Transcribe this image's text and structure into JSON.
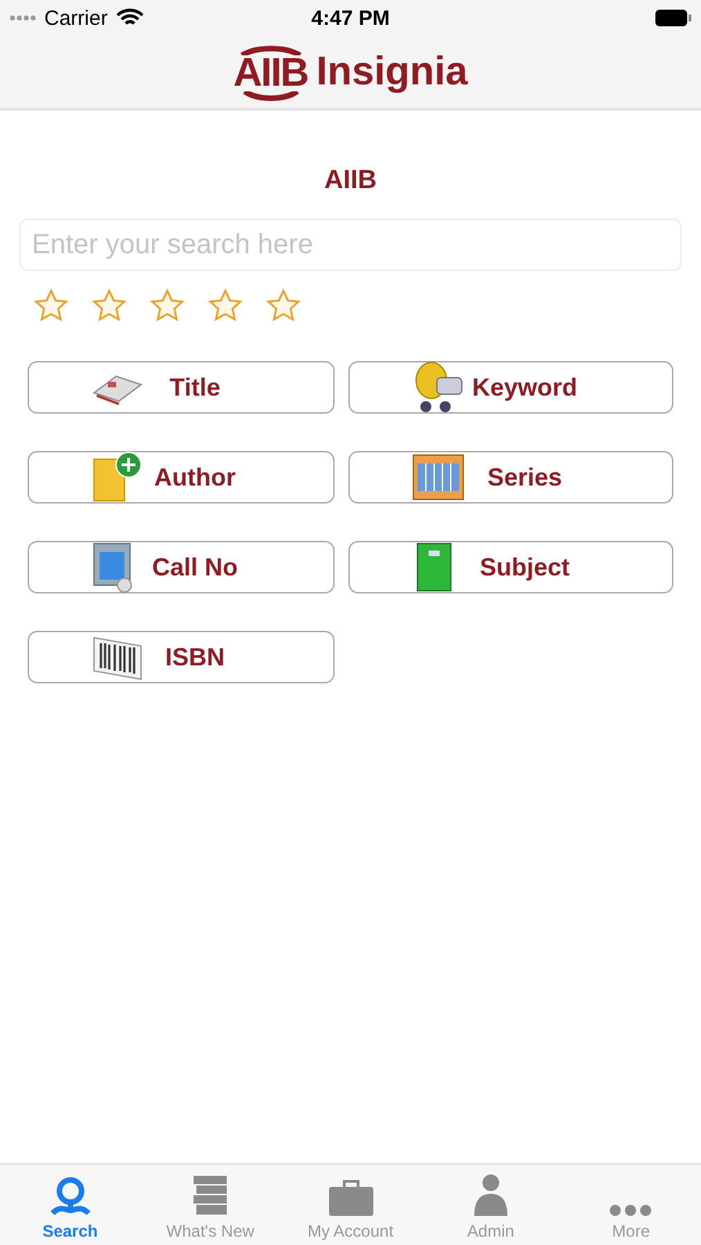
{
  "status_bar": {
    "carrier": "Carrier",
    "time": "4:47 PM"
  },
  "header": {
    "logo_mark": "AIIB",
    "logo_text": "Insignia"
  },
  "heading": "AIIB",
  "search": {
    "placeholder": "Enter your search here"
  },
  "rating": {
    "stars": 0
  },
  "search_buttons": [
    {
      "label": "Title",
      "kind": "title"
    },
    {
      "label": "Keyword",
      "kind": "keyword"
    },
    {
      "label": "Author",
      "kind": "author"
    },
    {
      "label": "Series",
      "kind": "series"
    },
    {
      "label": "Call No",
      "kind": "callno"
    },
    {
      "label": "Subject",
      "kind": "subject"
    },
    {
      "label": "ISBN",
      "kind": "isbn"
    }
  ],
  "tab_bar": [
    {
      "label": "Search",
      "kind": "search",
      "selected": true
    },
    {
      "label": "What's New",
      "kind": "books",
      "selected": false
    },
    {
      "label": "My Account",
      "kind": "briefcase",
      "selected": false
    },
    {
      "label": "Admin",
      "kind": "admin",
      "selected": false
    },
    {
      "label": "More",
      "kind": "more",
      "selected": false
    }
  ]
}
